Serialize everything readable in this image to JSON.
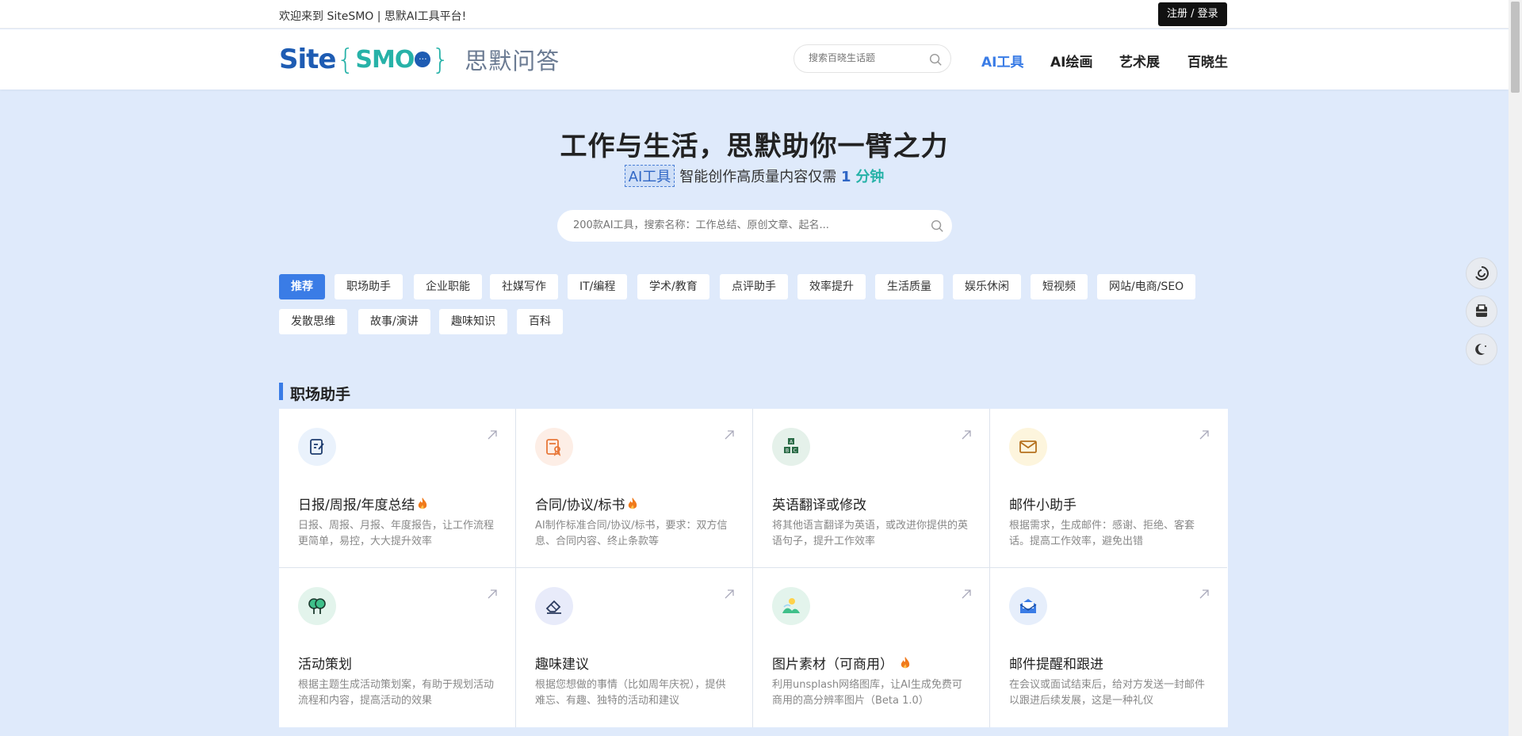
{
  "topbar": {
    "welcome": "欢迎来到 SiteSMO | 思默AI工具平台!",
    "login_label": "注册 / 登录"
  },
  "header": {
    "logo_site": "Site",
    "logo_smo": "SMO",
    "logo_cn": "思默问答",
    "search_placeholder": "搜索百晓生话题",
    "nav": [
      "AI工具",
      "AI绘画",
      "艺术展",
      "百晓生"
    ]
  },
  "hero": {
    "title": "工作与生活，思默助你一臂之力",
    "sub_tag": "AI工具",
    "sub_text": "智能创作高质量内容仅需",
    "sub_num": "1",
    "sub_unit": "分钟",
    "search_placeholder": "200款AI工具，搜索名称：工作总结、原创文章、起名..."
  },
  "categories": [
    "推荐",
    "职场助手",
    "企业职能",
    "社媒写作",
    "IT/编程",
    "学术/教育",
    "点评助手",
    "效率提升",
    "生活质量",
    "娱乐休闲",
    "短视频",
    "网站/电商/SEO",
    "发散思维",
    "故事/演讲",
    "趣味知识",
    "百科"
  ],
  "section": {
    "title": "职场助手",
    "cards": [
      {
        "title": "日报/周报/年度总结",
        "hot": true,
        "desc": "日报、周报、月报、年度报告，让工作流程更简单，易控，大大提升效率",
        "icon": "edit-document-icon"
      },
      {
        "title": "合同/协议/标书",
        "hot": true,
        "desc": "AI制作标准合同/协议/标书，要求：双方信息、合同内容、终止条款等",
        "icon": "contract-icon"
      },
      {
        "title": "英语翻译或修改",
        "hot": false,
        "desc": "将其他语言翻译为英语，或改进你提供的英语句子，提升工作效率",
        "icon": "abc-blocks-icon"
      },
      {
        "title": "邮件小助手",
        "hot": false,
        "desc": "根据需求，生成邮件：感谢、拒绝、客套话。提高工作效率，避免出错",
        "icon": "mail-icon"
      },
      {
        "title": "活动策划",
        "hot": false,
        "desc": "根据主题生成活动策划案，有助于规划活动流程和内容，提高活动的效果",
        "icon": "trees-icon"
      },
      {
        "title": "趣味建议",
        "hot": false,
        "desc": "根据您想做的事情（比如周年庆祝），提供难忘、有趣、独特的活动和建议",
        "icon": "eraser-icon"
      },
      {
        "title": "图片素材（可商用）",
        "hot": true,
        "desc": "利用unsplash网络图库，让AI生成免费可商用的高分辨率图片（Beta 1.0）",
        "icon": "landscape-icon"
      },
      {
        "title": "邮件提醒和跟进",
        "hot": false,
        "desc": "在会议或面试结束后，给对方发送一封邮件以跟进后续发展，这是一种礼仪",
        "icon": "open-mail-icon"
      }
    ]
  },
  "colors": {
    "accent": "#3a7ce6",
    "teal": "#27b2a8",
    "hero_bg": "#dfeafb",
    "fire": "#f07a1c"
  }
}
